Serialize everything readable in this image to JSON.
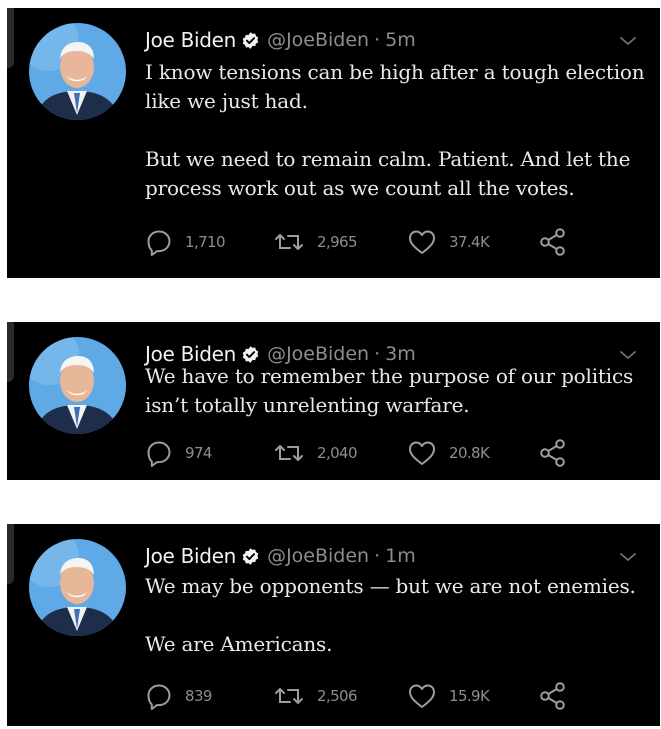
{
  "tweets": [
    {
      "author": {
        "name": "Joe Biden",
        "handle": "@JoeBiden",
        "separator": "·",
        "time": "5m"
      },
      "paragraphs": [
        "I know tensions can be high after a tough election like we just had.",
        "But we need to remain calm. Patient. And let the process work out as we count all the votes."
      ],
      "stats": {
        "replies": "1,710",
        "retweets": "2,965",
        "likes": "37.4K"
      }
    },
    {
      "author": {
        "name": "Joe Biden",
        "handle": "@JoeBiden",
        "separator": "·",
        "time": "3m"
      },
      "paragraphs": [
        "We have to remember the purpose of our politics isn’t totally unrelenting warfare."
      ],
      "stats": {
        "replies": "974",
        "retweets": "2,040",
        "likes": "20.8K"
      }
    },
    {
      "author": {
        "name": "Joe Biden",
        "handle": "@JoeBiden",
        "separator": "·",
        "time": "1m"
      },
      "paragraphs": [
        "We may be opponents — but we are not enemies.",
        "We are Americans."
      ],
      "stats": {
        "replies": "839",
        "retweets": "2,506",
        "likes": "15.9K"
      }
    }
  ],
  "icons": {
    "verified": "verified-badge-icon",
    "caret": "chevron-down-icon",
    "reply": "reply-icon",
    "retweet": "retweet-icon",
    "like": "heart-icon",
    "share": "share-icon"
  },
  "colors": {
    "background": "#000000",
    "text": "#e9e9e9",
    "secondary": "#8a8d91",
    "avatar_bg": "#5ea9e6"
  }
}
